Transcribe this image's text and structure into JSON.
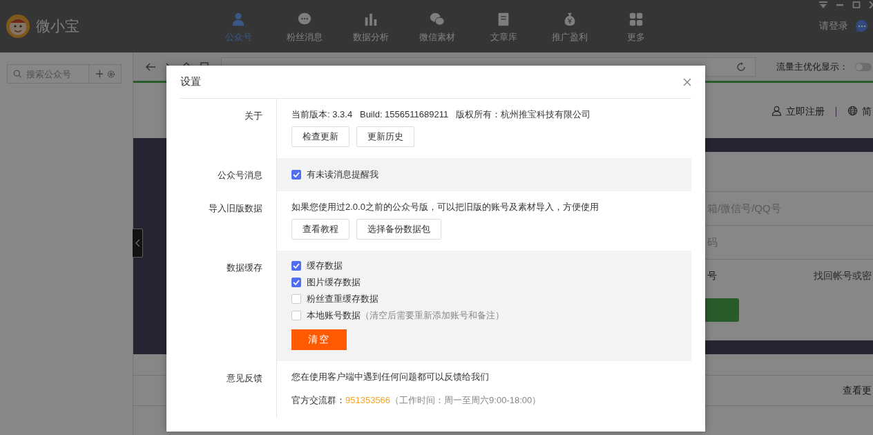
{
  "app": {
    "name": "微小宝",
    "login_link": "请登录",
    "nav": [
      {
        "label": "公众号",
        "selected": true,
        "kind": "person"
      },
      {
        "label": "粉丝消息",
        "selected": false,
        "kind": "chat"
      },
      {
        "label": "数据分析",
        "selected": false,
        "kind": "bars"
      },
      {
        "label": "微信素材",
        "selected": false,
        "kind": "bubbles"
      },
      {
        "label": "文章库",
        "selected": false,
        "kind": "book"
      },
      {
        "label": "推广盈利",
        "selected": false,
        "kind": "money"
      },
      {
        "label": "更多",
        "selected": false,
        "kind": "grid"
      }
    ]
  },
  "sidebar": {
    "search_placeholder": "搜索公众号"
  },
  "browser": {
    "traffic_label": "流量主优化显示：",
    "traffic_on": false
  },
  "page": {
    "register_link": "立即注册",
    "language": "简",
    "account_placeholder": "箱/微信号/QQ号",
    "password_placeholder": "码",
    "remember_label": "号",
    "recover_link": "找回帐号或密",
    "more_link": "查看更"
  },
  "dialog": {
    "title": "设置",
    "sections": [
      {
        "label": "关于",
        "shaded": false,
        "text": "当前版本: 3.3.4   Build: 1556511689211   版权所有：杭州推宝科技有限公司",
        "buttons": [
          "检查更新",
          "更新历史"
        ]
      },
      {
        "label": "公众号消息",
        "shaded": true,
        "checkboxes": [
          {
            "label": "有未读消息提醒我",
            "checked": true
          }
        ]
      },
      {
        "label": "导入旧版数据",
        "shaded": false,
        "text": "如果您使用过2.0.0之前的公众号版，可以把旧版的账号及素材导入，方便使用",
        "buttons": [
          "查看教程",
          "选择备份数据包"
        ]
      },
      {
        "label": "数据缓存",
        "shaded": true,
        "checkboxes": [
          {
            "label": "缓存数据",
            "checked": true
          },
          {
            "label": "图片缓存数据",
            "checked": true
          },
          {
            "label": "粉丝查重缓存数据",
            "checked": false
          },
          {
            "label": "本地账号数据",
            "note": "（清空后需要重新添加账号和备注）",
            "checked": false
          }
        ],
        "action_button": "清空"
      },
      {
        "label": "意见反馈",
        "shaded": false,
        "text": "您在使用客户端中遇到任何问题都可以反馈给我们",
        "contact": {
          "label": "官方交流群：",
          "number": "951353566",
          "note": "（工作时间：周一至周六9:00-18:00）"
        }
      }
    ]
  }
}
